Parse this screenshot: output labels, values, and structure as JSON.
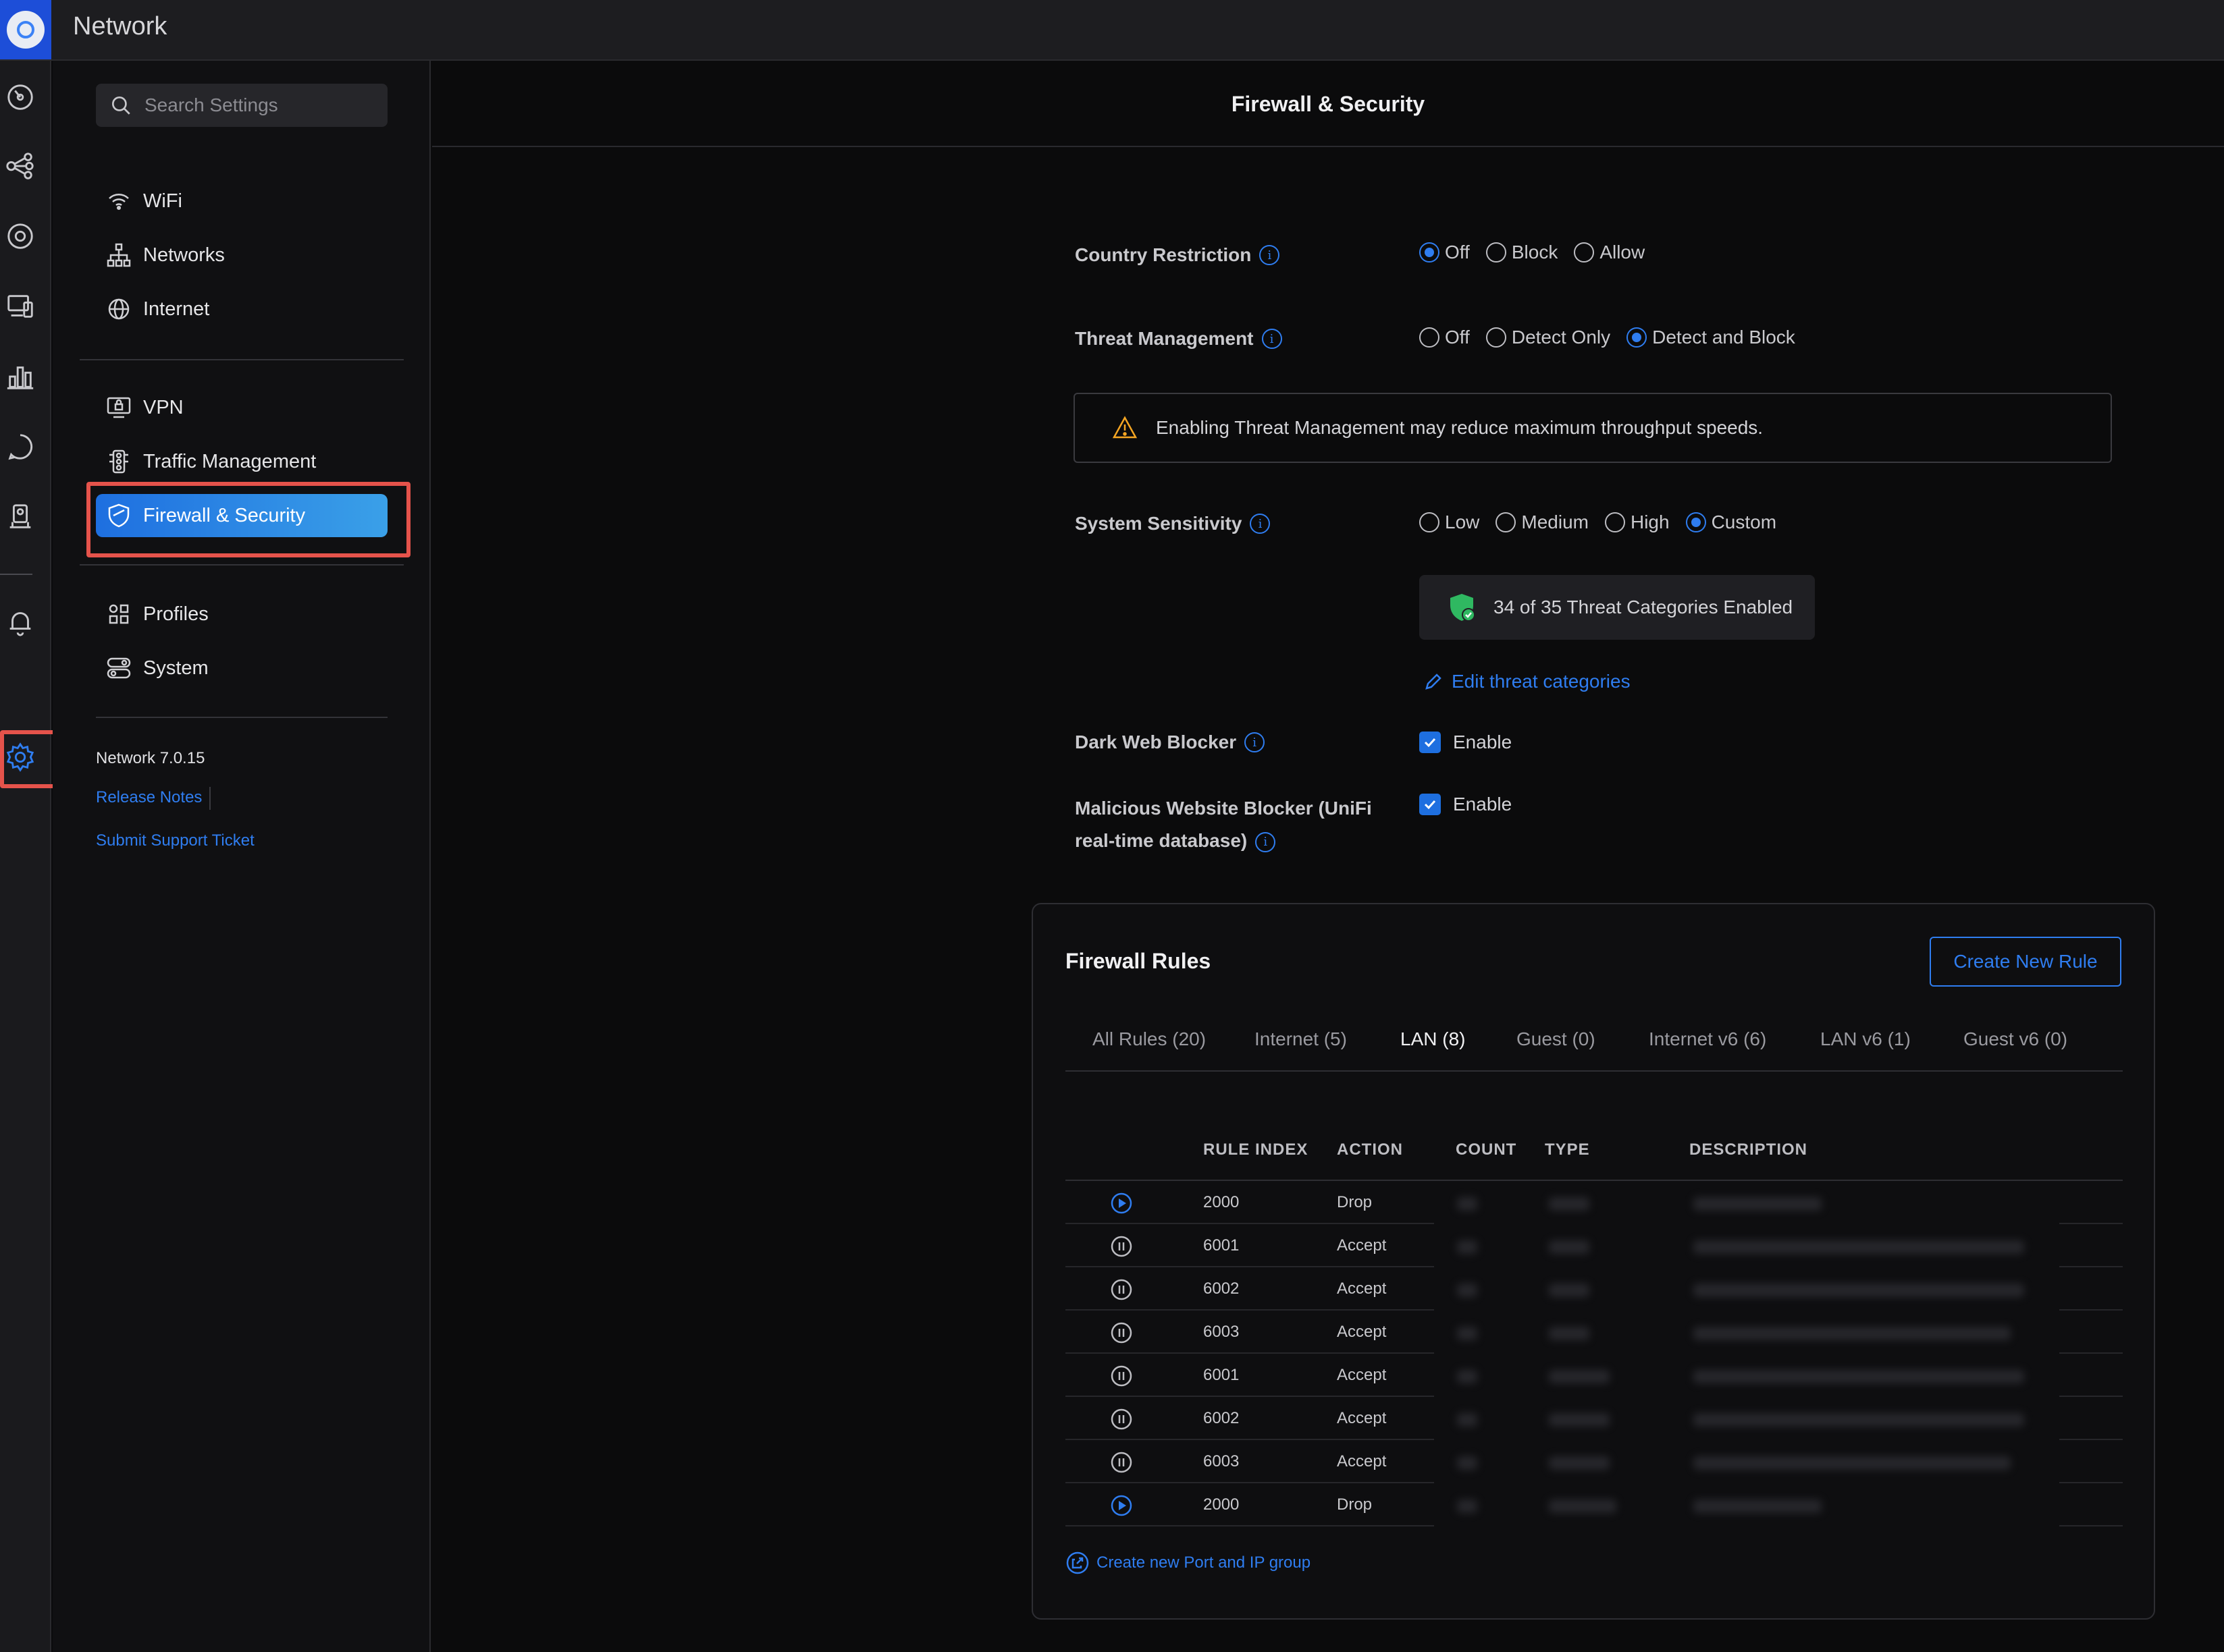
{
  "app": {
    "title": "Network"
  },
  "search": {
    "placeholder": "Search Settings"
  },
  "sidebar": {
    "items": [
      {
        "label": "WiFi",
        "icon": "wifi-icon"
      },
      {
        "label": "Networks",
        "icon": "network-tree-icon"
      },
      {
        "label": "Internet",
        "icon": "globe-icon"
      },
      {
        "label": "VPN",
        "icon": "vpn-icon"
      },
      {
        "label": "Traffic Management",
        "icon": "traffic-light-icon"
      },
      {
        "label": "Firewall & Security",
        "icon": "shield-icon",
        "active": true
      },
      {
        "label": "Profiles",
        "icon": "profiles-grid-icon"
      },
      {
        "label": "System",
        "icon": "system-toggle-icon"
      }
    ],
    "version": "Network 7.0.15",
    "release_notes": "Release Notes",
    "support": "Submit Support Ticket"
  },
  "main": {
    "title": "Firewall & Security",
    "country_restriction": {
      "label": "Country Restriction",
      "options": [
        "Off",
        "Block",
        "Allow"
      ],
      "selected": "Off"
    },
    "threat_management": {
      "label": "Threat Management",
      "options": [
        "Off",
        "Detect Only",
        "Detect and Block"
      ],
      "selected": "Detect and Block",
      "warning": "Enabling Threat Management may reduce maximum throughput speeds."
    },
    "system_sensitivity": {
      "label": "System Sensitivity",
      "options": [
        "Low",
        "Medium",
        "High",
        "Custom"
      ],
      "selected": "Custom",
      "categories_summary": "34 of 35 Threat Categories Enabled",
      "edit_link": "Edit threat categories"
    },
    "dark_web_blocker": {
      "label": "Dark Web Blocker",
      "checkbox_label": "Enable",
      "checked": true
    },
    "malicious_blocker": {
      "label": "Malicious Website Blocker (UniFi real-time database)",
      "checkbox_label": "Enable",
      "checked": true
    }
  },
  "firewall": {
    "title": "Firewall Rules",
    "create_button": "Create New Rule",
    "tabs": [
      "All Rules (20)",
      "Internet (5)",
      "LAN (8)",
      "Guest (0)",
      "Internet v6 (6)",
      "LAN v6 (1)",
      "Guest v6 (0)"
    ],
    "active_tab": "LAN (8)",
    "columns": [
      "RULE INDEX",
      "ACTION",
      "COUNT",
      "TYPE",
      "DESCRIPTION"
    ],
    "rows": [
      {
        "index": "2000",
        "action": "Drop",
        "state": "play"
      },
      {
        "index": "6001",
        "action": "Accept",
        "state": "pause"
      },
      {
        "index": "6002",
        "action": "Accept",
        "state": "pause"
      },
      {
        "index": "6003",
        "action": "Accept",
        "state": "pause"
      },
      {
        "index": "6001",
        "action": "Accept",
        "state": "pause"
      },
      {
        "index": "6002",
        "action": "Accept",
        "state": "pause"
      },
      {
        "index": "6003",
        "action": "Accept",
        "state": "pause"
      },
      {
        "index": "2000",
        "action": "Drop",
        "state": "play"
      }
    ],
    "port_group_link": "Create new Port and IP group"
  },
  "colors": {
    "accent": "#2f7df0",
    "highlight": "#e5534b",
    "warning": "#f5a623",
    "success": "#2fb861"
  }
}
